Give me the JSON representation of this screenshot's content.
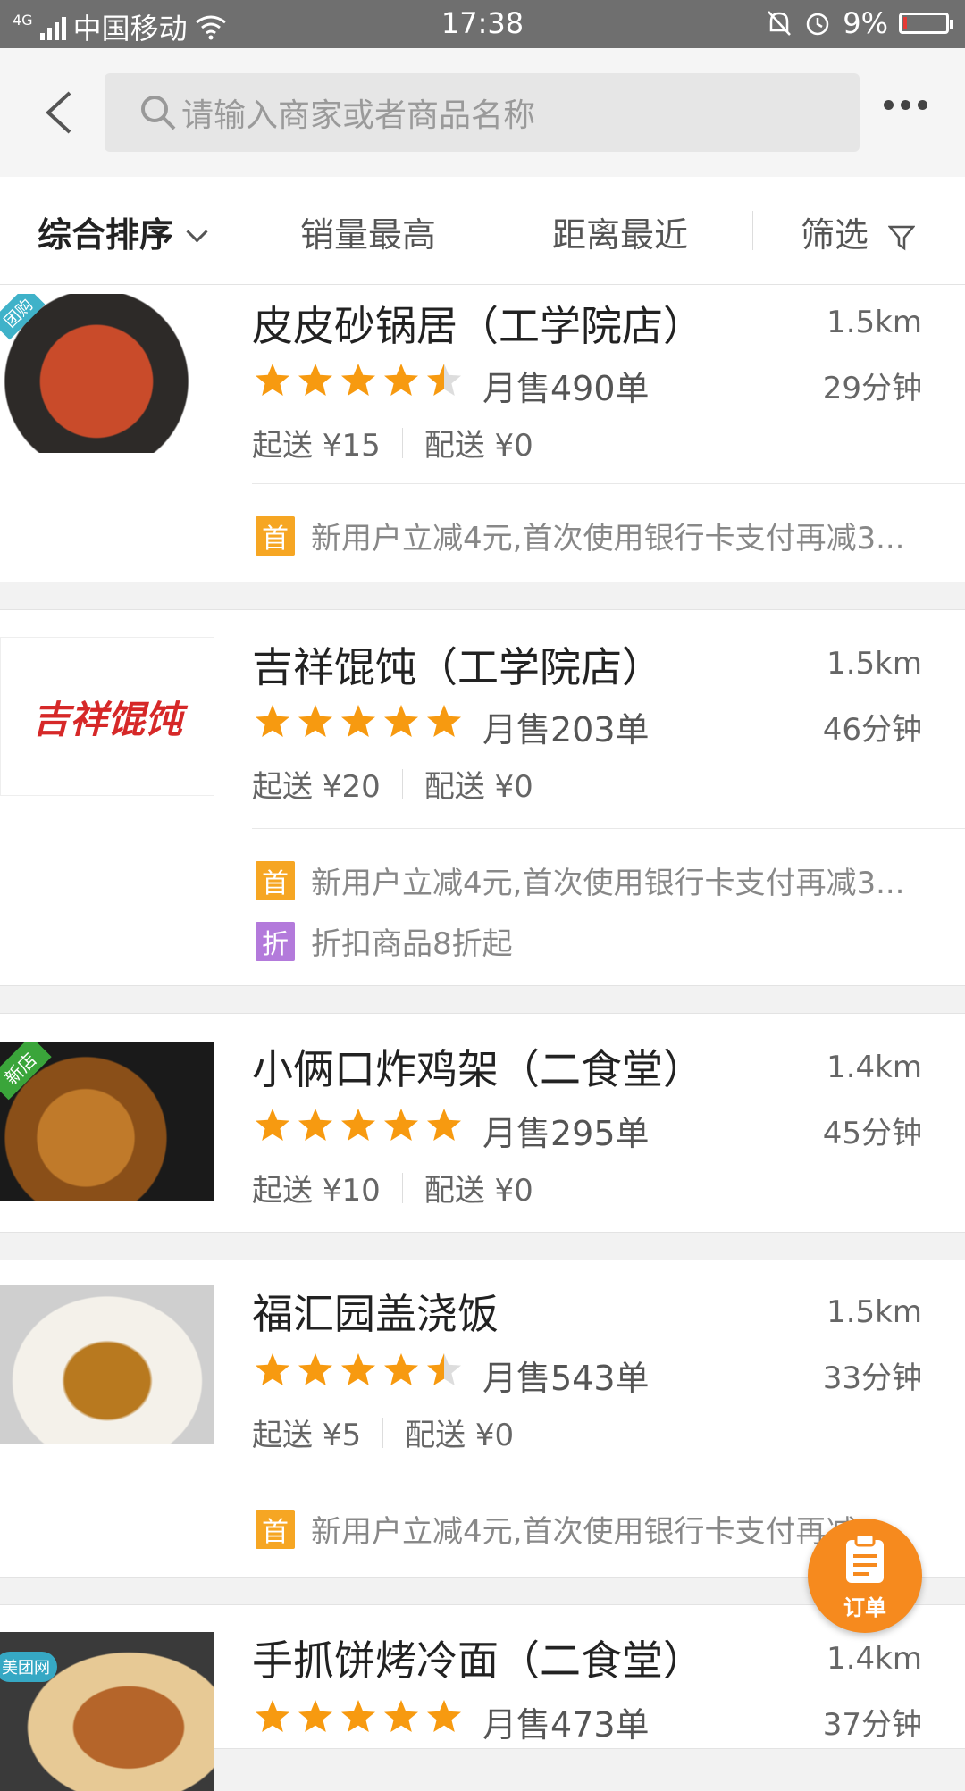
{
  "status_bar": {
    "network": "4G",
    "carrier": "中国移动",
    "time": "17:38",
    "battery": "9%",
    "battery_level": 0.09
  },
  "search": {
    "placeholder": "请输入商家或者商品名称"
  },
  "sort_bar": {
    "items": [
      "综合排序",
      "销量最高",
      "距离最近",
      "筛选"
    ]
  },
  "colors": {
    "accent": "#f6a623",
    "star": "#f79a10",
    "star_empty": "#dddddd",
    "fab": "#f68a1e",
    "discount": "#b37adb"
  },
  "stores": [
    {
      "name": "皮皮砂锅居（工学院店）",
      "distance": "1.5km",
      "rating": 4.5,
      "monthly_sales": "月售490单",
      "delivery_time": "29分钟",
      "min_order": "起送 ¥15",
      "delivery_fee": "配送 ¥0",
      "tag": "团购",
      "promos": [
        {
          "badge": "首",
          "text": "新用户立减4元,首次使用银行卡支付再减3..."
        }
      ]
    },
    {
      "name": "吉祥馄饨（工学院店）",
      "distance": "1.5km",
      "rating": 5,
      "monthly_sales": "月售203单",
      "delivery_time": "46分钟",
      "min_order": "起送 ¥20",
      "delivery_fee": "配送 ¥0",
      "logo_text": "吉祥馄饨",
      "promos": [
        {
          "badge": "首",
          "text": "新用户立减4元,首次使用银行卡支付再减3..."
        },
        {
          "badge": "折",
          "text": "折扣商品8折起"
        }
      ]
    },
    {
      "name": "小俩口炸鸡架（二食堂）",
      "distance": "1.4km",
      "rating": 5,
      "monthly_sales": "月售295单",
      "delivery_time": "45分钟",
      "min_order": "起送 ¥10",
      "delivery_fee": "配送 ¥0",
      "tag": "新店",
      "promos": []
    },
    {
      "name": "福汇园盖浇饭",
      "distance": "1.5km",
      "rating": 4.5,
      "monthly_sales": "月售543单",
      "delivery_time": "33分钟",
      "min_order": "起送 ¥5",
      "delivery_fee": "配送 ¥0",
      "promos": [
        {
          "badge": "首",
          "text": "新用户立减4元,首次使用银行卡支付再减3..."
        }
      ]
    },
    {
      "name": "手抓饼烤冷面（二食堂）",
      "distance": "1.4km",
      "rating": 5,
      "monthly_sales": "月售473单",
      "delivery_time": "37分钟",
      "tag": "美团网",
      "promos": []
    }
  ],
  "fab": {
    "label": "订单"
  }
}
